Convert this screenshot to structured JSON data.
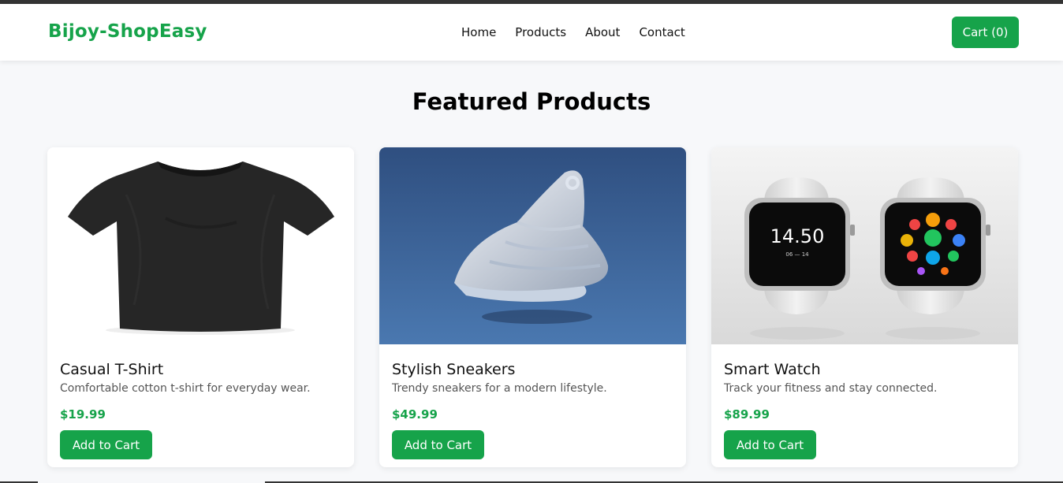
{
  "header": {
    "brand": "Bijoy-ShopEasy",
    "nav": [
      "Home",
      "Products",
      "About",
      "Contact"
    ],
    "cart_label": "Cart (0)"
  },
  "main": {
    "title": "Featured Products",
    "products": [
      {
        "name": "Casual T-Shirt",
        "description": "Comfortable cotton t-shirt for everyday wear.",
        "price": "$19.99",
        "button": "Add to Cart",
        "image": "black-tshirt-image"
      },
      {
        "name": "Stylish Sneakers",
        "description": "Trendy sneakers for a modern lifestyle.",
        "price": "$49.99",
        "button": "Add to Cart",
        "image": "white-sneaker-image"
      },
      {
        "name": "Smart Watch",
        "description": "Track your fitness and stay connected.",
        "price": "$89.99",
        "button": "Add to Cart",
        "image": "smartwatch-pair-image",
        "watch_time": "14.50",
        "watch_date": "06 — 14"
      }
    ]
  },
  "colors": {
    "accent": "#16a34a",
    "background": "#f7f8fa",
    "card": "#ffffff",
    "sneaker_bg": "#3a5f95"
  }
}
